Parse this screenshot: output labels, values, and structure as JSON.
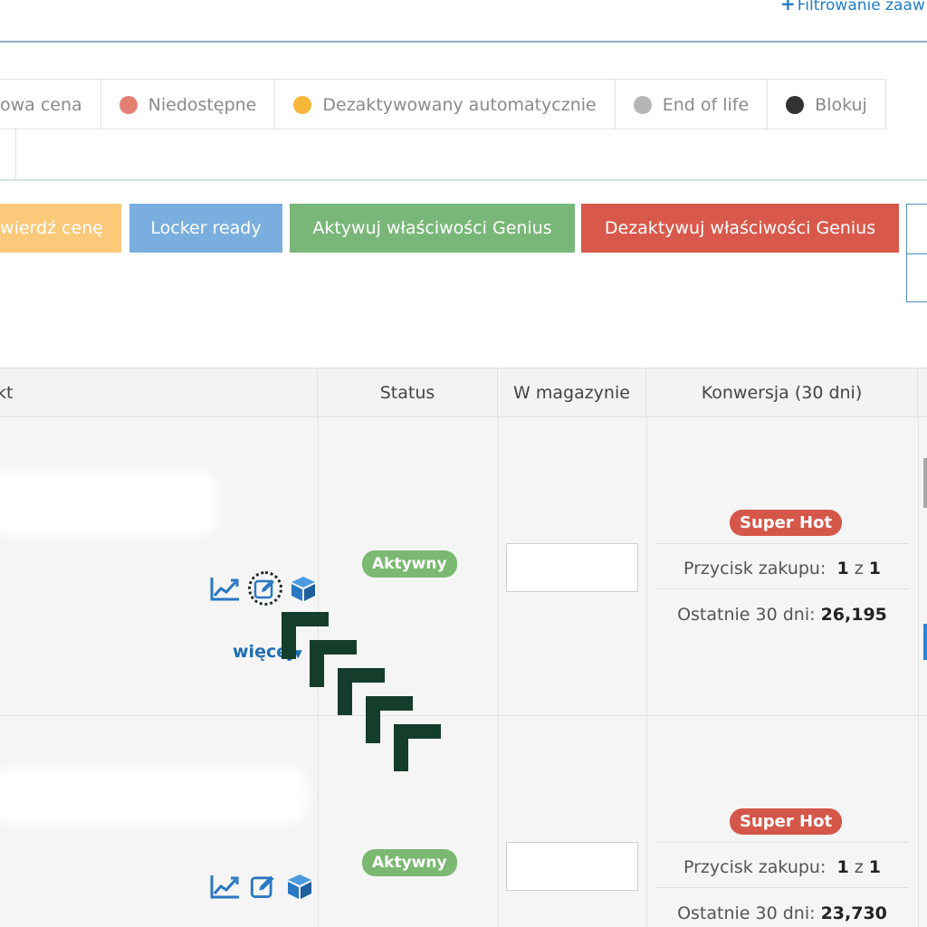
{
  "header": {
    "advanced_filter_label": "Filtrowanie zaaw",
    "plus_icon": "plus-icon"
  },
  "legend": [
    {
      "label": "owa cena",
      "color": ""
    },
    {
      "label": "Niedostępne",
      "color": "#e57f74"
    },
    {
      "label": "Dezaktywowany automatycznie",
      "color": "#f8b73a"
    },
    {
      "label": "End of life",
      "color": "#b5b5b5"
    },
    {
      "label": "Blokuj",
      "color": "#333333"
    }
  ],
  "actions": {
    "confirm_price": "wierdź cenę",
    "locker_ready": "Locker ready",
    "activate_genius": "Aktywuj właściwości Genius",
    "deactivate_genius": "Dezaktywuj właściwości Genius"
  },
  "table": {
    "headers": {
      "product": "kt",
      "status": "Status",
      "stock": "W magazynie",
      "conversion": "Konwersja (30 dni)"
    },
    "rows": [
      {
        "status": "Aktywny",
        "more": "więcej",
        "badge": "Super Hot",
        "buybox_label": "Przycisk zakupu:",
        "buybox_pos": "1",
        "buybox_sep": "z",
        "buybox_total": "1",
        "last30_label": "Ostatnie 30 dni:",
        "last30_value": "26,195"
      },
      {
        "status": "Aktywny",
        "badge": "Super Hot",
        "buybox_label": "Przycisk zakupu:",
        "buybox_pos": "1",
        "buybox_sep": "z",
        "buybox_total": "1",
        "last30_label": "Ostatnie 30 dni:",
        "last30_value": "23,730"
      }
    ]
  },
  "colors": {
    "accent_blue": "#1f7dc8",
    "active_green": "#7bb872",
    "hot_red": "#d5574a",
    "cursor_dark": "#143d2b"
  }
}
